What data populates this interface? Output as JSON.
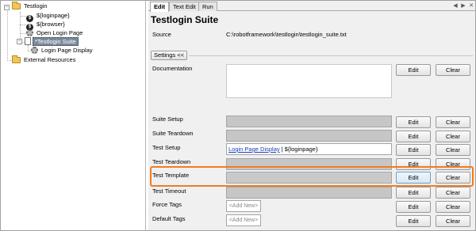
{
  "tree": {
    "root": "Testlogin",
    "items": [
      {
        "label": "${loginpage}",
        "icon": "dollar-variable-icon"
      },
      {
        "label": "${browser}",
        "icon": "dollar-variable-icon"
      },
      {
        "label": "Open Login Page",
        "icon": "gear-icon"
      },
      {
        "label": "*Testlogin Suite",
        "icon": "suite-icon"
      },
      {
        "label": "Login Page Display",
        "icon": "gear-icon"
      }
    ],
    "external": "External Resources"
  },
  "tabs": [
    "Edit",
    "Text Edit",
    "Run"
  ],
  "suite": {
    "title": "Testlogin Suite",
    "source_label": "Source",
    "source_value": "C:\\robotframework\\testlogin\\testlogin_suite.txt"
  },
  "settings_button": "Settings <<",
  "edit_label": "Edit",
  "clear_label": "Clear",
  "add_new": "<Add New>",
  "settings": {
    "documentation": "Documentation",
    "suite_setup": "Suite Setup",
    "suite_teardown": "Suite Teardown",
    "test_setup": "Test Setup",
    "test_setup_link": "Login Page Display",
    "test_setup_rest": " | ${loginpage}",
    "test_teardown": "Test Teardown",
    "test_template": "Test Template",
    "test_timeout": "Test Timeout",
    "force_tags": "Force Tags",
    "default_tags": "Default Tags"
  },
  "colors": {
    "highlight": "#f07d22",
    "selected_tree_item": "#7a8a9e",
    "link": "#1a3fb5"
  }
}
